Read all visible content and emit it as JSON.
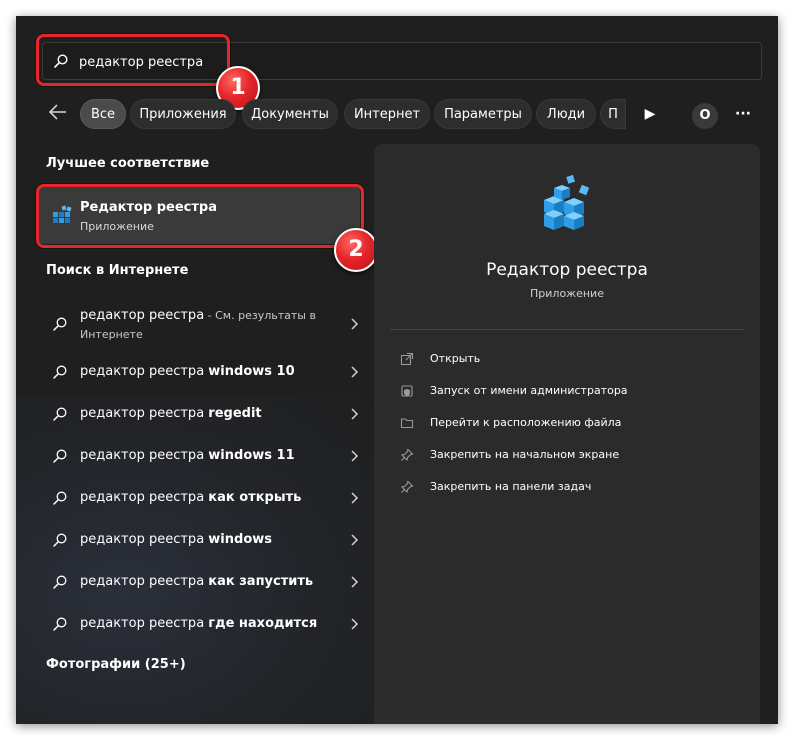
{
  "search": {
    "value": "редактор реестра",
    "icon": "search-icon"
  },
  "filters": {
    "back_icon": "arrow-left-icon",
    "chips": [
      "Все",
      "Приложения",
      "Документы",
      "Интернет",
      "Параметры",
      "Люди",
      "П"
    ],
    "active": "Все",
    "play_glyph": "▶",
    "avatar_letter": "O",
    "more_glyph": "···"
  },
  "callouts": [
    "1",
    "2"
  ],
  "left": {
    "best_heading": "Лучшее соответствие",
    "best": {
      "title": "Редактор реестра",
      "subtitle": "Приложение",
      "icon": "registry-editor-icon"
    },
    "web_heading": "Поиск в Интернете",
    "web_items": [
      {
        "query": "редактор реестра",
        "suffix": "",
        "note": " - См. результаты в Интернете"
      },
      {
        "query": "редактор реестра ",
        "suffix": "windows 10",
        "note": ""
      },
      {
        "query": "редактор реестра ",
        "suffix": "regedit",
        "note": ""
      },
      {
        "query": "редактор реестра ",
        "suffix": "windows 11",
        "note": ""
      },
      {
        "query": "редактор реестра ",
        "suffix": "как открыть",
        "note": ""
      },
      {
        "query": "редактор реестра ",
        "suffix": "windows",
        "note": ""
      },
      {
        "query": "редактор реестра ",
        "suffix": "как запустить",
        "note": ""
      },
      {
        "query": "редактор реестра ",
        "suffix": "где находится",
        "note": ""
      }
    ],
    "photos_heading": "Фотографии (25+)"
  },
  "details": {
    "name": "Редактор реестра",
    "kind": "Приложение",
    "actions": [
      {
        "label": "Открыть",
        "icon": "open-icon"
      },
      {
        "label": "Запуск от имени администратора",
        "icon": "admin-shield-icon"
      },
      {
        "label": "Перейти к расположению файла",
        "icon": "folder-icon"
      },
      {
        "label": "Закрепить на начальном экране",
        "icon": "pin-icon"
      },
      {
        "label": "Закрепить на панели задач",
        "icon": "pin-icon"
      }
    ]
  },
  "colors": {
    "panel": "#1f1f1f",
    "detail": "#2b2b2b",
    "accent": "#e5262b",
    "tile": "#2e9fe6"
  }
}
